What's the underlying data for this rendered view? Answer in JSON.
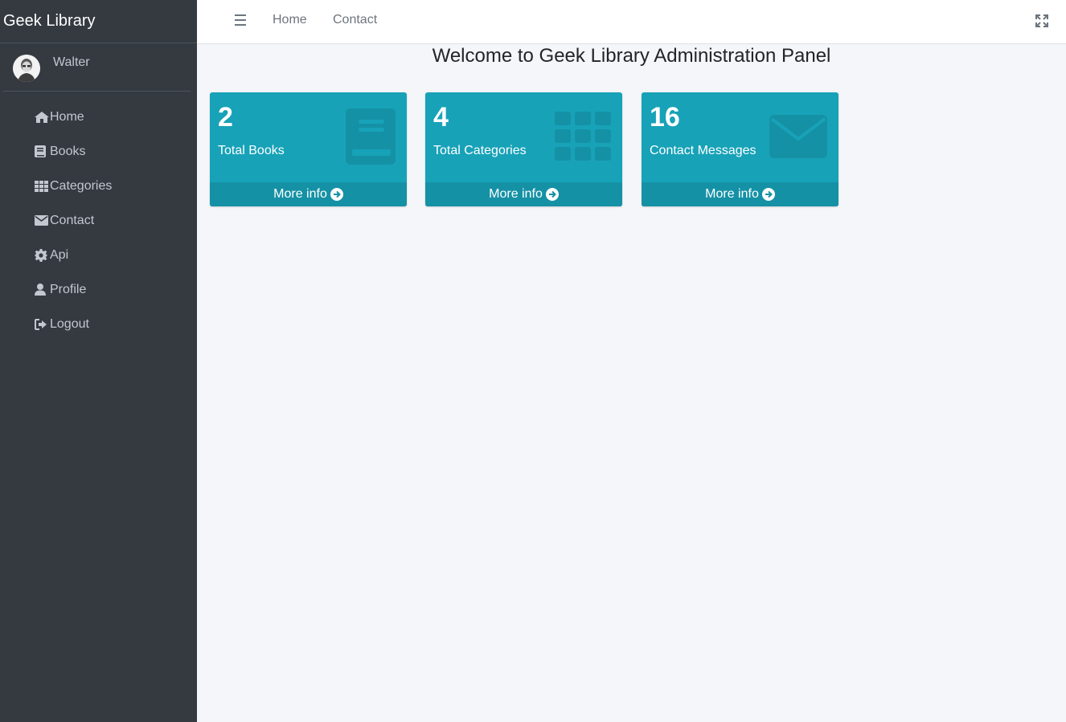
{
  "sidebar": {
    "brand": "Geek Library",
    "user_name": "Walter",
    "items": [
      {
        "label": "Home",
        "icon": "home-icon"
      },
      {
        "label": "Books",
        "icon": "book-icon"
      },
      {
        "label": "Categories",
        "icon": "grid-icon"
      },
      {
        "label": "Contact",
        "icon": "envelope-icon"
      },
      {
        "label": "Api",
        "icon": "gear-icon"
      },
      {
        "label": "Profile",
        "icon": "user-icon"
      },
      {
        "label": "Logout",
        "icon": "logout-icon"
      }
    ]
  },
  "navbar": {
    "links": [
      "Home",
      "Contact"
    ]
  },
  "main": {
    "title": "Welcome to Geek Library Administration Panel",
    "cards": [
      {
        "value": "2",
        "label": "Total Books",
        "footer": "More info",
        "icon": "book-icon"
      },
      {
        "value": "4",
        "label": "Total Categories",
        "footer": "More info",
        "icon": "grid-icon"
      },
      {
        "value": "16",
        "label": "Contact Messages",
        "footer": "More info",
        "icon": "envelope-icon"
      }
    ]
  },
  "colors": {
    "sidebar_bg": "#343a40",
    "card_bg": "#17a2b8",
    "card_footer_bg": "#1591a5",
    "content_bg": "#f4f6f9"
  }
}
